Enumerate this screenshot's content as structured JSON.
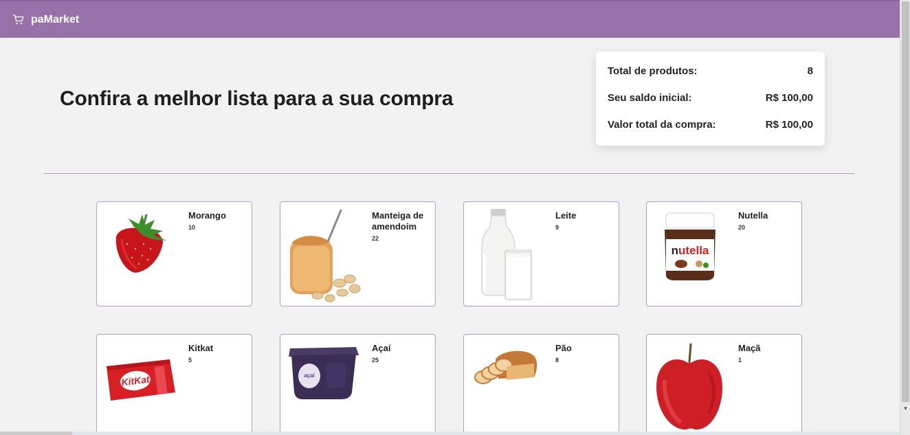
{
  "header": {
    "brand": "paMarket",
    "icon": "cart-icon"
  },
  "hero": {
    "title": "Confira a melhor lista para a sua compra"
  },
  "summary": {
    "rows": [
      {
        "label": "Total de produtos:",
        "value": "8"
      },
      {
        "label": "Seu saldo inicial:",
        "value": "R$ 100,00"
      },
      {
        "label": "Valor total da compra:",
        "value": "R$ 100,00"
      }
    ]
  },
  "products": [
    {
      "name": "Morango",
      "qty": "10",
      "image": "strawberry"
    },
    {
      "name": "Manteiga de amendoim",
      "qty": "22",
      "image": "peanut-butter-jar"
    },
    {
      "name": "Leite",
      "qty": "9",
      "image": "milk-bottle"
    },
    {
      "name": "Nutella",
      "qty": "20",
      "image": "nutella-jar"
    },
    {
      "name": "Kitkat",
      "qty": "5",
      "image": "kitkat-bar"
    },
    {
      "name": "Açaí",
      "qty": "25",
      "image": "acai-tub"
    },
    {
      "name": "Pão",
      "qty": "8",
      "image": "sliced-bread"
    },
    {
      "name": "Maçã",
      "qty": "1",
      "image": "red-apple"
    }
  ],
  "colors": {
    "header": "#9771aa",
    "card_border": "#b89ad0",
    "background": "#f2f2f2"
  }
}
